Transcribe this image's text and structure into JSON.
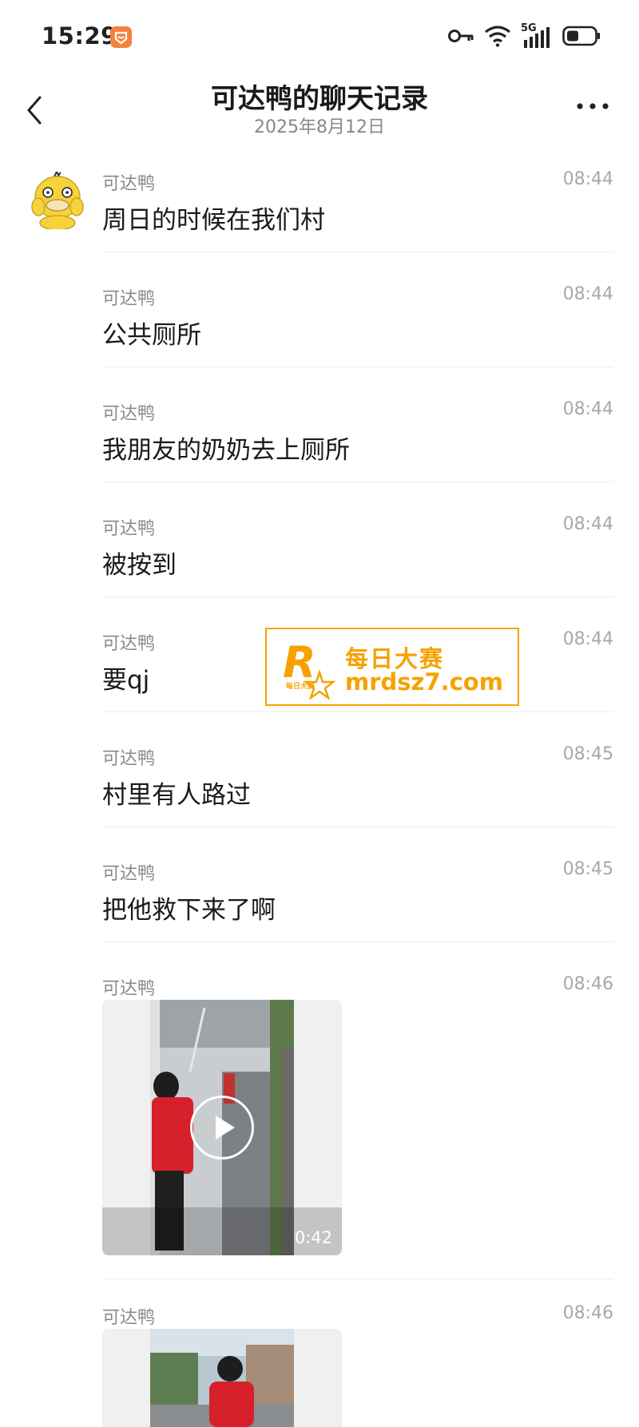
{
  "status_bar": {
    "time": "15:29",
    "network": "5G"
  },
  "header": {
    "title": "可达鸭的聊天记录",
    "subtitle": "2025年8月12日"
  },
  "messages": [
    {
      "sender": "可达鸭",
      "time": "08:44",
      "text": "周日的时候在我们村"
    },
    {
      "sender": "可达鸭",
      "time": "08:44",
      "text": "公共厕所"
    },
    {
      "sender": "可达鸭",
      "time": "08:44",
      "text": "我朋友的奶奶去上厕所"
    },
    {
      "sender": "可达鸭",
      "time": "08:44",
      "text": "被按到"
    },
    {
      "sender": "可达鸭",
      "time": "08:44",
      "text": "要qj"
    },
    {
      "sender": "可达鸭",
      "time": "08:45",
      "text": "村里有人路过"
    },
    {
      "sender": "可达鸭",
      "time": "08:45",
      "text": "把他救下来了啊"
    },
    {
      "sender": "可达鸭",
      "time": "08:46",
      "video_duration": "0:42"
    },
    {
      "sender": "可达鸭",
      "time": "08:46"
    }
  ],
  "watermark": {
    "logo_letter": "R",
    "logo_sub": "每日大赛",
    "name": "每日大赛",
    "url": "mrdsz7.com"
  },
  "colors": {
    "accent": "#f5a200",
    "status_icon": "#f5823a"
  }
}
